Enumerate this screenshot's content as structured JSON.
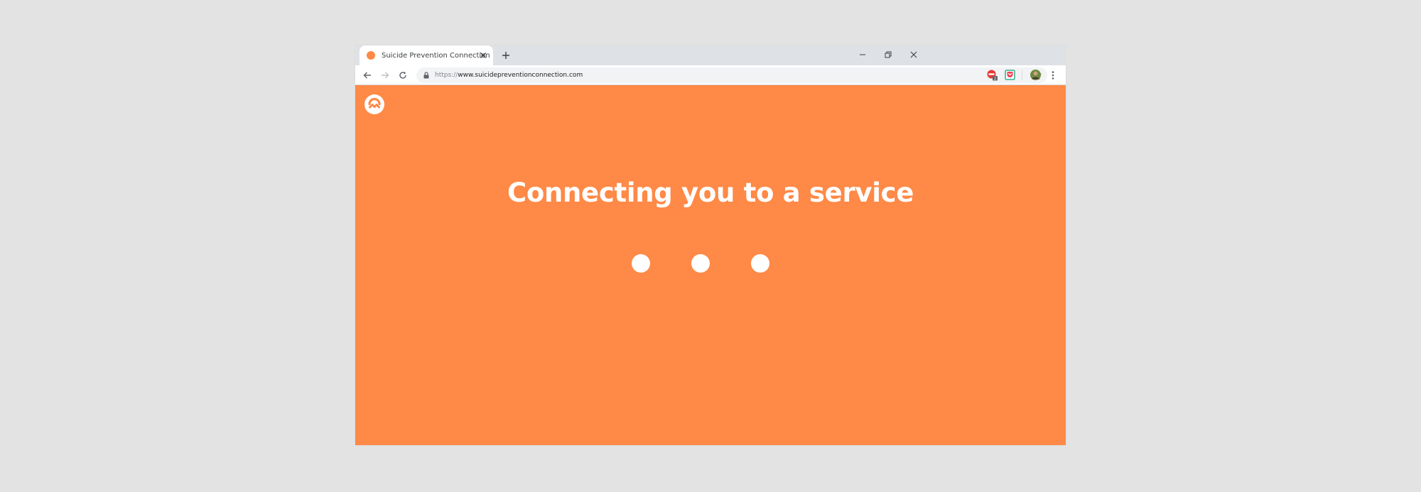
{
  "browser": {
    "tab": {
      "title": "Suicide Prevention Connection",
      "favicon": "orange-circle-favicon"
    },
    "address_bar": {
      "scheme": "https://",
      "host": "www.suicidepreventionconnection.com"
    },
    "extensions": [
      {
        "name": "red-extension-icon",
        "badge": "2"
      },
      {
        "name": "pocket-extension-icon"
      },
      {
        "name": "profile-avatar"
      }
    ]
  },
  "page": {
    "heading": "Connecting you to a service",
    "loading_indicator": "three-dot-loader"
  },
  "colors": {
    "page_background": "#ff8946",
    "text": "#ffffff",
    "tabstrip": "#dee1e6",
    "desktop": "#e3e3e3"
  }
}
